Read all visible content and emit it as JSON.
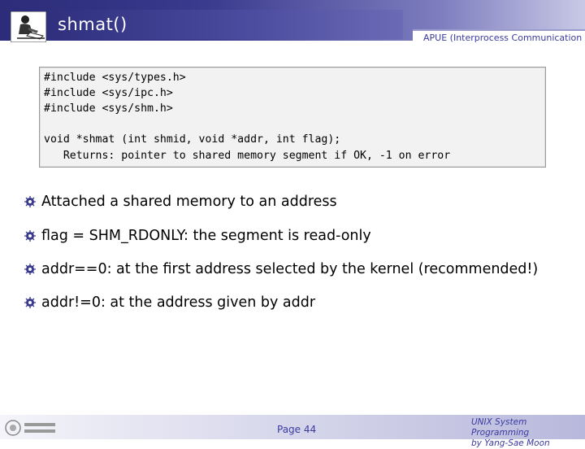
{
  "header": {
    "title": "shmat()",
    "subtitle": "APUE (Interprocess Communication"
  },
  "code": {
    "lines": [
      "#include <sys/types.h>",
      "#include <sys/ipc.h>",
      "#include <sys/shm.h>",
      "void *shmat (int shmid, void *addr, int flag);",
      "   Returns: pointer to shared memory segment if OK, -1 on error"
    ]
  },
  "bullets": [
    "Attached a shared memory to an address",
    "flag = SHM_RDONLY: the segment is read-only",
    "addr==0: at the first address selected by the kernel (recommended!)",
    "addr!=0: at the address given by addr"
  ],
  "footer": {
    "page": "Page 44",
    "course_line1": "UNIX System Programming",
    "course_line2": "by Yang-Sae Moon"
  },
  "colors": {
    "header_dark": "#2c2c7a",
    "accent_text": "#3a3aa0"
  },
  "icons": [
    "reading-person-logo",
    "bullet-icon",
    "university-logo"
  ]
}
